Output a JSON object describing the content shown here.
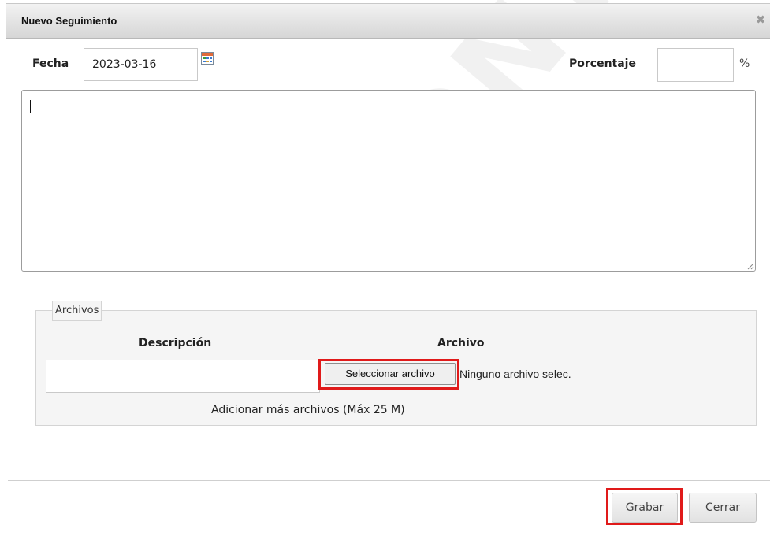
{
  "dialog": {
    "title": "Nuevo Seguimiento",
    "close_icon": "close-icon"
  },
  "form": {
    "fecha_label": "Fecha",
    "fecha_value": "2023-03-16",
    "calendar_icon": "calendar-icon",
    "porcentaje_label": "Porcentaje",
    "porcentaje_value": "",
    "porcentaje_unit": "%",
    "comment_value": ""
  },
  "archivos": {
    "legend": "Archivos",
    "columns": [
      "Descripción",
      "Archivo"
    ],
    "descripcion_value": "",
    "select_file_label": "Seleccionar archivo",
    "no_file_text": "Ninguno archivo selec.",
    "add_more_label": "Adicionar más archivos (Máx 25 M)"
  },
  "footer": {
    "save_label": "Grabar",
    "close_label": "Cerrar"
  },
  "watermark": {
    "text": "CONTROLADO"
  },
  "colors": {
    "highlight": "#e01a1a",
    "title_bar": "#dedede",
    "panel_bg": "#f5f5f5"
  }
}
